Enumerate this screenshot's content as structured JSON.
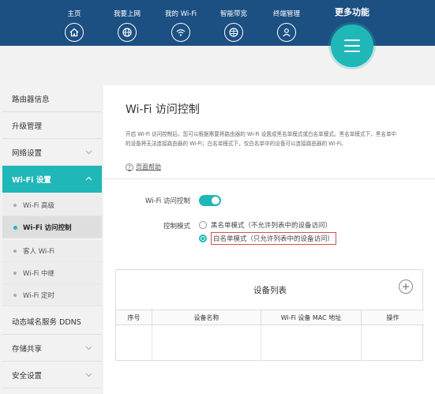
{
  "nav": {
    "items": [
      {
        "label": "主页",
        "icon": "home-icon"
      },
      {
        "label": "我要上网",
        "icon": "globe-icon"
      },
      {
        "label": "我的 Wi-Fi",
        "icon": "wifi-icon"
      },
      {
        "label": "智能带宽",
        "icon": "bandwidth-globe-icon"
      },
      {
        "label": "终端管理",
        "icon": "user-icon"
      }
    ],
    "more_label": "更多功能",
    "more_icon": "menu-icon"
  },
  "sidebar": {
    "router_info": "路由器信息",
    "upgrade": "升级管理",
    "network": "网络设置",
    "wifi_settings": "Wi-Fi 设置",
    "wifi_sub": [
      "Wi-Fi 高级",
      "Wi-Fi 访问控制",
      "客人 Wi-Fi",
      "Wi-Fi 中继",
      "Wi-Fi 定时"
    ],
    "ddns": "动态域名服务 DDNS",
    "storage": "存储共享",
    "security": "安全设置"
  },
  "content": {
    "title": "Wi-Fi 访问控制",
    "desc_line1": "开启 Wi-Fi 访问控制后，您可以根据需要将路由器的 Wi-Fi 设置成黑名单模式或白名单模式。黑名单模式下，黑名单中",
    "desc_line2": "的设备将无法连接路由器的 Wi-Fi；白名单模式下，仅白名单中的设备可以连接路由器的 Wi-Fi。",
    "help": "页面帮助",
    "toggle_label": "Wi-Fi 访问控制",
    "toggle_on": true,
    "mode_label": "控制模式",
    "mode_blacklist": "黑名单模式（不允许列表中的设备访问）",
    "mode_whitelist": "白名单模式（只允许列表中的设备访问）",
    "selected_mode": "whitelist"
  },
  "device_table": {
    "title": "设备列表",
    "columns": [
      "序号",
      "设备名称",
      "Wi-Fi 设备 MAC 地址",
      "操作"
    ]
  },
  "colors": {
    "header": "#1c4f82",
    "accent": "#1fb7b7",
    "highlight_border": "#d9534f"
  }
}
